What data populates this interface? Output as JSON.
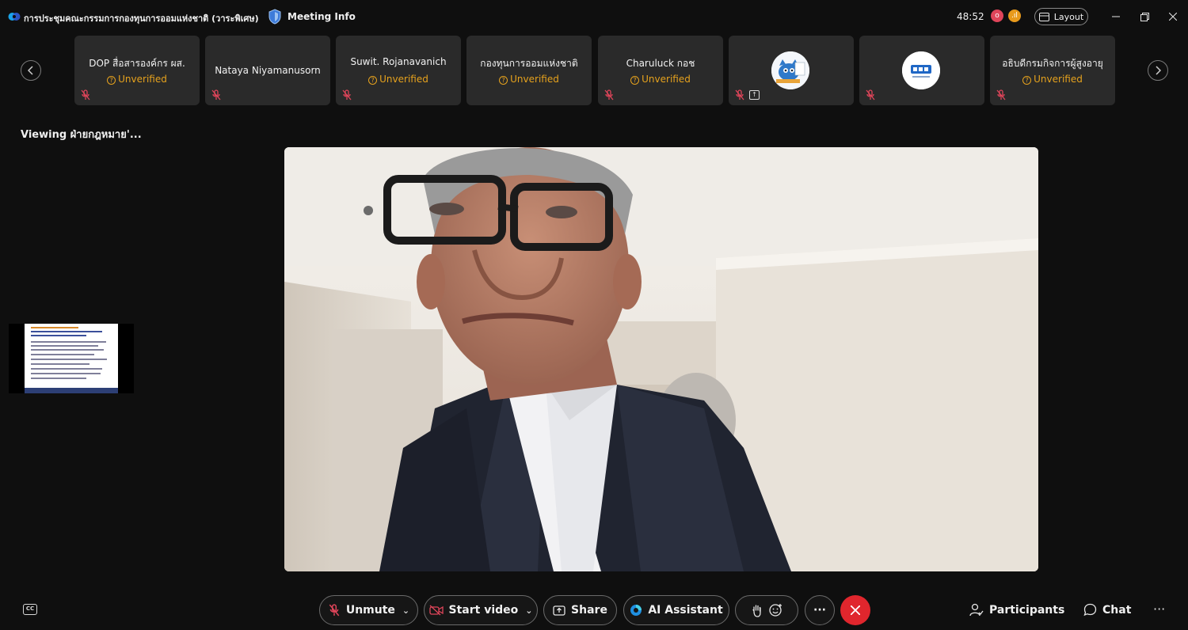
{
  "titlebar": {
    "meeting_title": "การประชุมคณะกรรมการกองทุนการออมแห่งชาติ (วาระพิเศษ)",
    "meeting_info": "Meeting Info",
    "timer": "48:52",
    "layout_label": "Layout",
    "rec_glyph": "o",
    "net_glyph": ".ıl"
  },
  "participants": [
    {
      "name": "DOP สื่อสารองค์กร ผส.",
      "status": "Unverified"
    },
    {
      "name": "Nataya Niyamanusorn",
      "status": ""
    },
    {
      "name": "Suwit. Rojanavanich",
      "status": "Unverified"
    },
    {
      "name": "กองทุนการออมแห่งชาติ",
      "status": "Unverified"
    },
    {
      "name": "Charuluck กอช",
      "status": "Unverified"
    },
    {
      "name": "",
      "status": ""
    },
    {
      "name": "",
      "status": ""
    },
    {
      "name": "อธิบดีกรมกิจการผู้สูงอายุ",
      "status": "Unverified"
    }
  ],
  "viewing_label": "Viewing ฝ่ายกฎหมาย'...",
  "toolbar": {
    "unmute": "Unmute",
    "start_video": "Start video",
    "share": "Share",
    "ai_assistant": "AI Assistant",
    "participants": "Participants",
    "chat": "Chat"
  },
  "colors": {
    "unverified": "#e6a21d",
    "end_call": "#e0262d",
    "mic_off": "#e0455a"
  }
}
